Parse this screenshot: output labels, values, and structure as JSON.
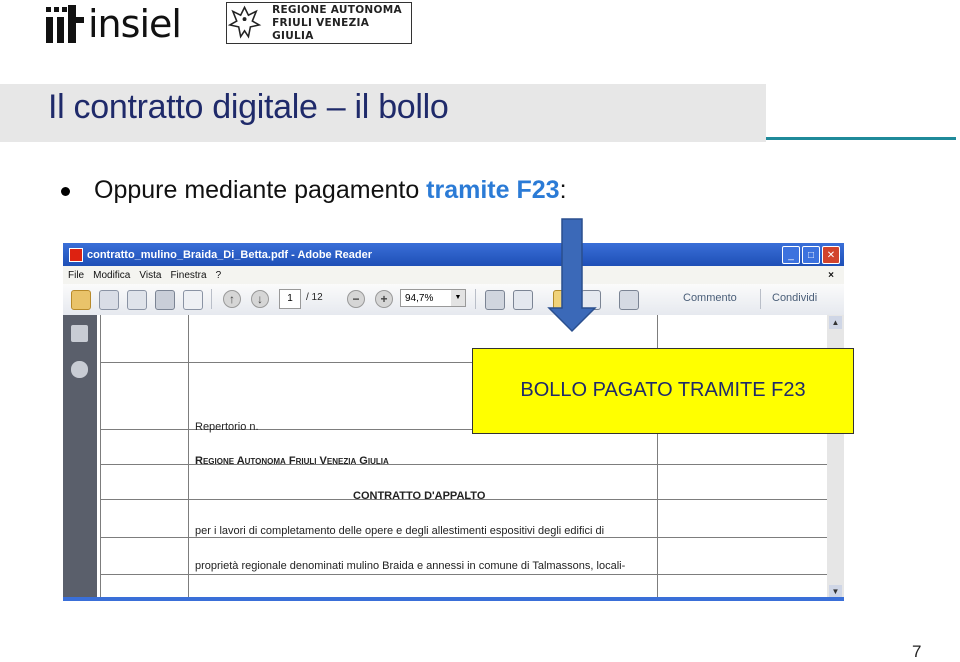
{
  "header": {
    "insiel_logo_text": "insiel",
    "regione_logo_line1": "REGIONE AUTONOMA",
    "regione_logo_line2": "FRIULI VENEZIA GIULIA"
  },
  "slide": {
    "title": "Il contratto digitale – il bollo",
    "bullet_prefix": "Oppure mediante pagamento ",
    "bullet_highlight": "tramite F23",
    "bullet_suffix": ":",
    "callout": "BOLLO PAGATO TRAMITE F23",
    "page_number": "7",
    "colors": {
      "title": "#1f2a6a",
      "highlight": "#2b7bd6",
      "callout_bg": "#ffff00",
      "arrow": "#3b69b8",
      "accent_rule": "#1f8a9a"
    }
  },
  "reader": {
    "window_title": "contratto_mulino_Braida_Di_Betta.pdf - Adobe Reader",
    "menu": [
      "File",
      "Modifica",
      "Vista",
      "Finestra",
      "?"
    ],
    "menu_close": "×",
    "page_current": "1",
    "page_total": "/ 12",
    "zoom": "94,7%",
    "comment_label": "Commento",
    "share_label": "Condividi",
    "window_buttons": [
      "minimize",
      "maximize",
      "close"
    ],
    "document": {
      "repertorio": "Repertorio n.",
      "regione": "Regione Autonoma Friuli Venezia Giulia",
      "contratto": "CONTRATTO D'APPALTO",
      "line1": "per i lavori di completamento delle opere e degli allestimenti espositivi degli edifici di",
      "line2": "proprietà regionale denominati mulino Braida e annessi in comune di Talmassons, locali-"
    }
  }
}
